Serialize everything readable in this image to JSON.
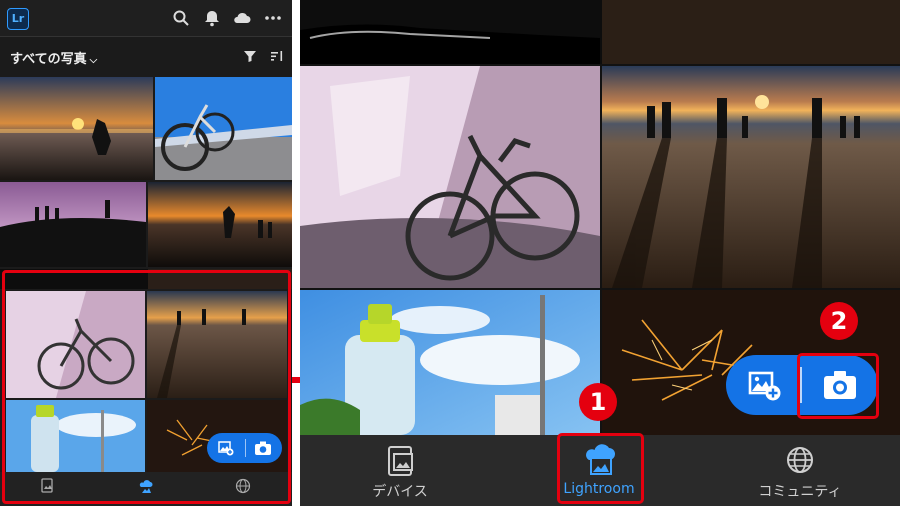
{
  "app": {
    "logo_text": "Lr",
    "album_title": "すべての写真",
    "toolbar_icons": [
      "search-icon",
      "bell-icon",
      "cloud-icon",
      "more-icon"
    ],
    "filter_icons": [
      "filter-icon",
      "sort-icon"
    ]
  },
  "nav": {
    "items": [
      {
        "label": "デバイス",
        "icon": "device-photos-icon",
        "active": false
      },
      {
        "label": "Lightroom",
        "icon": "cloud-photos-icon",
        "active": true
      },
      {
        "label": "コミュニティ",
        "icon": "globe-icon",
        "active": false
      }
    ]
  },
  "fab": {
    "add_icon": "add-photo-icon",
    "camera_icon": "camera-icon"
  },
  "callouts": {
    "step1": "1",
    "step2": "2"
  },
  "colors": {
    "accent": "#1473e6",
    "highlight": "#e4000f",
    "active_nav": "#3fa3ff"
  }
}
